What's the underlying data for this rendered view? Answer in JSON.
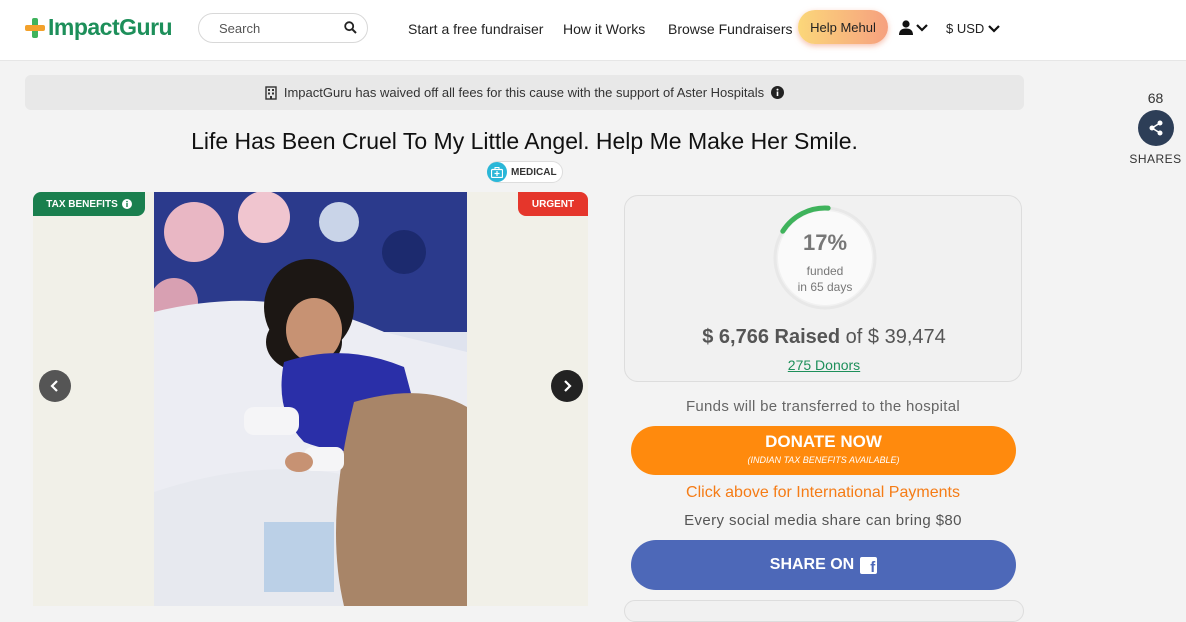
{
  "header": {
    "logo_text": "ImpactGuru",
    "search": {
      "placeholder": "Search"
    },
    "nav": [
      "Start a free fundraiser",
      "How it Works",
      "Browse Fundraisers"
    ],
    "help_button": "Help Mehul",
    "currency": "$ USD"
  },
  "notice": {
    "text": "ImpactGuru has waived off all fees for this cause with the support of Aster Hospitals"
  },
  "shares": {
    "count": "68",
    "label": "SHARES"
  },
  "campaign": {
    "title": "Life Has Been Cruel To My Little Angel. Help Me Make Her Smile.",
    "category": "MEDICAL",
    "tax_badge": "TAX BENEFITS",
    "urgent_badge": "URGENT"
  },
  "stats": {
    "funded_percent": "17%",
    "funded_fraction": 0.17,
    "funded_label": "funded",
    "days_label": "in 65 days",
    "raised_amount": "$ 6,766 Raised",
    "raised_of": "of $ 39,474",
    "donors": "275 Donors"
  },
  "actions": {
    "transfer_note": "Funds will be transferred to the hospital",
    "donate_label": "DONATE NOW",
    "donate_sub": "(INDIAN TAX BENEFITS AVAILABLE)",
    "intl_link": "Click above for International Payments",
    "share_note": "Every social media share can bring $80",
    "share_label": "SHARE ON"
  },
  "colors": {
    "brand_green": "#1d8f5a",
    "donate_orange": "#ff8a0d",
    "urgent_red": "#e5362b",
    "facebook_blue": "#4d68b8"
  }
}
